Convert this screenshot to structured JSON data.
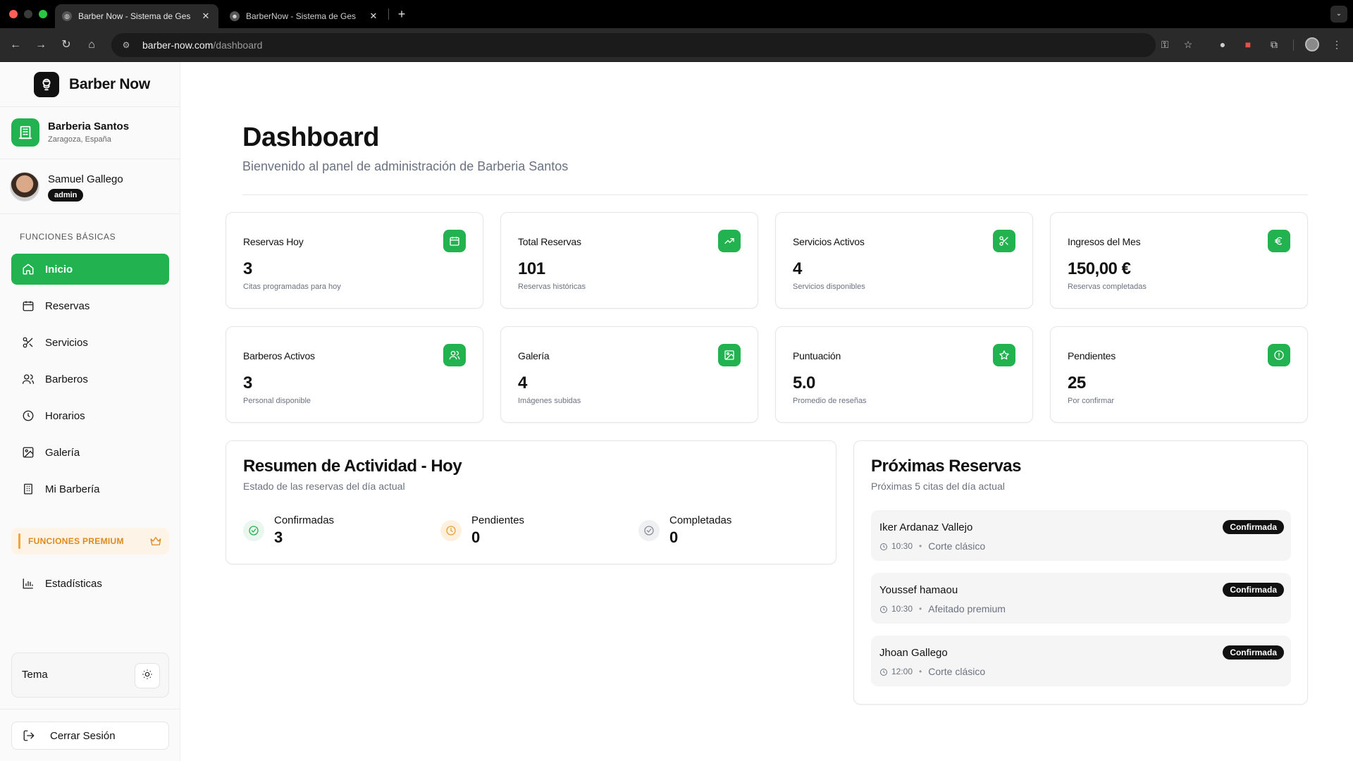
{
  "browser": {
    "tabs": [
      {
        "title": "Barber Now - Sistema de Ges"
      },
      {
        "title": "BarberNow - Sistema de Ges"
      }
    ],
    "url_host": "barber-now.com",
    "url_path": "/dashboard"
  },
  "brand": {
    "name": "Barber Now"
  },
  "shop": {
    "name": "Barberia Santos",
    "location": "Zaragoza, España"
  },
  "user": {
    "name": "Samuel Gallego",
    "role": "admin"
  },
  "sidebar": {
    "section_basic": "FUNCIONES BÁSICAS",
    "items": [
      {
        "label": "Inicio",
        "icon": "home-icon",
        "active": true
      },
      {
        "label": "Reservas",
        "icon": "calendar-icon"
      },
      {
        "label": "Servicios",
        "icon": "scissors-icon"
      },
      {
        "label": "Barberos",
        "icon": "users-icon"
      },
      {
        "label": "Horarios",
        "icon": "clock-icon"
      },
      {
        "label": "Galería",
        "icon": "image-icon"
      },
      {
        "label": "Mi Barbería",
        "icon": "building-icon"
      }
    ],
    "section_premium": "FUNCIONES PREMIUM",
    "premium_items": [
      {
        "label": "Estadísticas",
        "icon": "bar-chart-icon"
      }
    ],
    "theme_label": "Tema",
    "logout_label": "Cerrar Sesión"
  },
  "header": {
    "title": "Dashboard",
    "subtitle": "Bienvenido al panel de administración de Barberia Santos"
  },
  "stats": [
    {
      "label": "Reservas Hoy",
      "value": "3",
      "desc": "Citas programadas para hoy",
      "icon": "calendar-icon"
    },
    {
      "label": "Total Reservas",
      "value": "101",
      "desc": "Reservas históricas",
      "icon": "trending-up-icon"
    },
    {
      "label": "Servicios Activos",
      "value": "4",
      "desc": "Servicios disponibles",
      "icon": "scissors-icon"
    },
    {
      "label": "Ingresos del Mes",
      "value": "150,00 €",
      "desc": "Reservas completadas",
      "icon": "euro-icon"
    },
    {
      "label": "Barberos Activos",
      "value": "3",
      "desc": "Personal disponible",
      "icon": "users-icon"
    },
    {
      "label": "Galería",
      "value": "4",
      "desc": "Imágenes subidas",
      "icon": "image-icon"
    },
    {
      "label": "Puntuación",
      "value": "5.0",
      "desc": "Promedio de reseñas",
      "icon": "star-icon"
    },
    {
      "label": "Pendientes",
      "value": "25",
      "desc": "Por confirmar",
      "icon": "alert-circle-icon"
    }
  ],
  "activity": {
    "title": "Resumen de Actividad - Hoy",
    "subtitle": "Estado de las reservas del día actual",
    "items": [
      {
        "label": "Confirmadas",
        "value": "3",
        "color": "#22b350"
      },
      {
        "label": "Pendientes",
        "value": "0",
        "color": "#e8a23a"
      },
      {
        "label": "Completadas",
        "value": "0",
        "color": "#8a8f98"
      }
    ]
  },
  "upcoming": {
    "title": "Próximas Reservas",
    "subtitle": "Próximas 5 citas del día actual",
    "items": [
      {
        "name": "Iker Ardanaz Vallejo",
        "time": "10:30",
        "service": "Corte clásico",
        "status": "Confirmada"
      },
      {
        "name": "Youssef hamaou",
        "time": "10:30",
        "service": "Afeitado premium",
        "status": "Confirmada"
      },
      {
        "name": "Jhoan Gallego",
        "time": "12:00",
        "service": "Corte clásico",
        "status": "Confirmada"
      }
    ]
  },
  "colors": {
    "accent": "#22b350",
    "premium": "#e08a17"
  }
}
